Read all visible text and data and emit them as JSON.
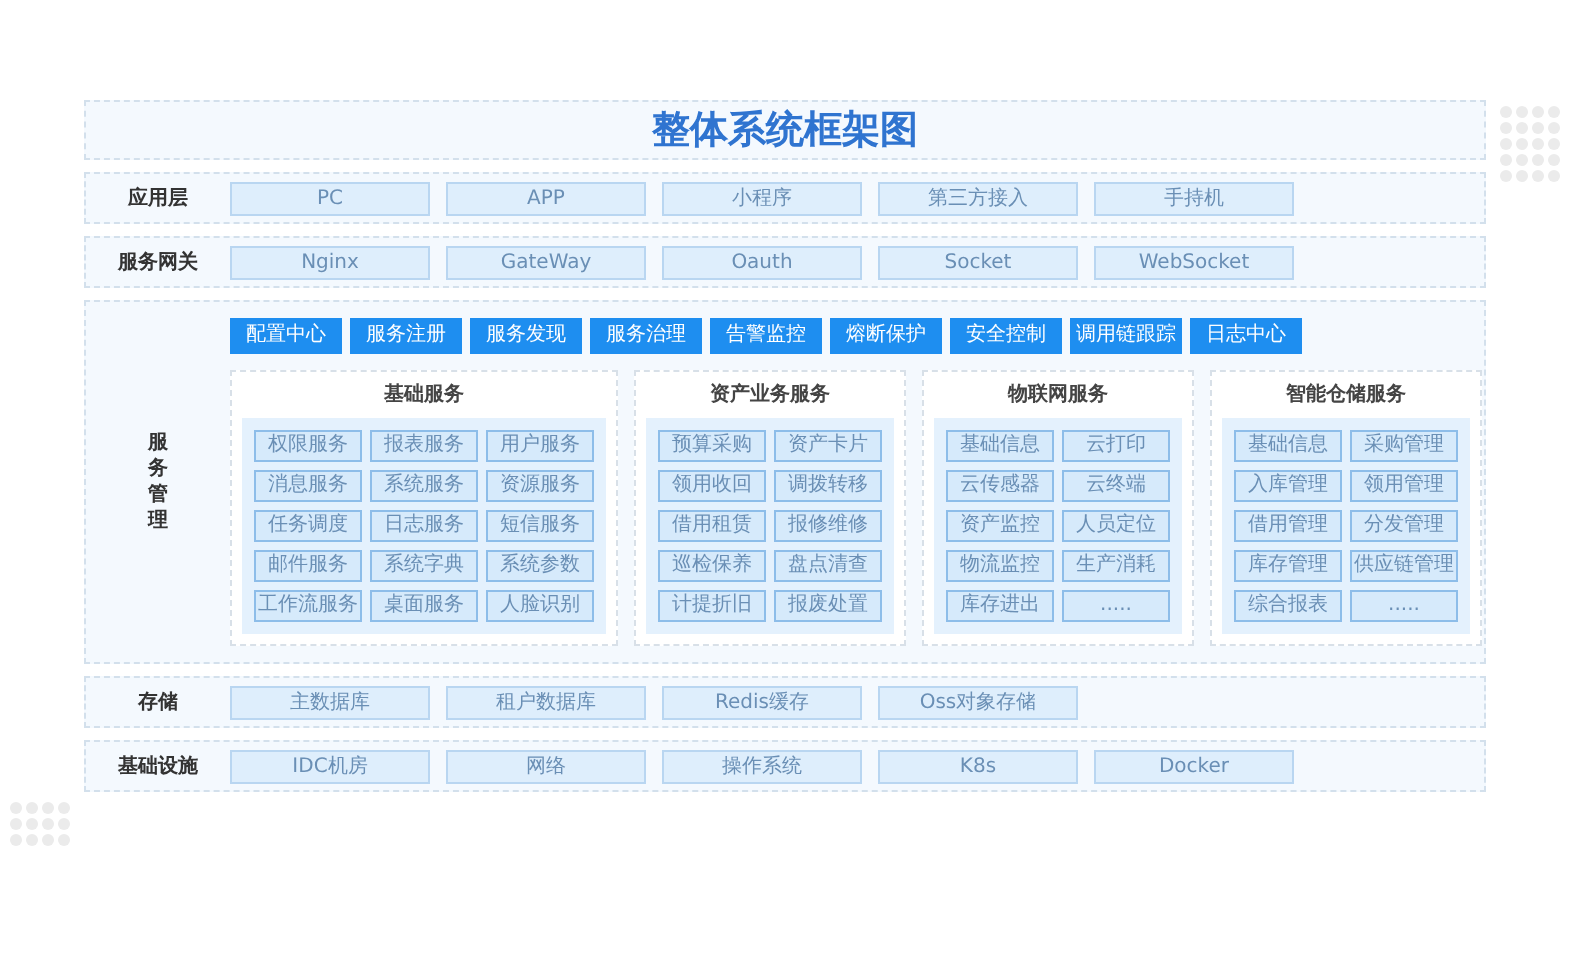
{
  "title": "整体系统框架图",
  "layers": [
    {
      "kind": "row",
      "label": "应用层",
      "items": [
        "PC",
        "APP",
        "小程序",
        "第三方接入",
        "手持机"
      ]
    },
    {
      "kind": "row",
      "label": "服务网关",
      "items": [
        "Nginx",
        "GateWay",
        "Oauth",
        "Socket",
        "WebSocket"
      ]
    },
    {
      "kind": "services",
      "label": "服务管理",
      "modules": [
        "配置中心",
        "服务注册",
        "服务发现",
        "服务治理",
        "告警监控",
        "熔断保护",
        "安全控制",
        "调用链跟踪",
        "日志中心"
      ],
      "groups": [
        {
          "title": "基础服务",
          "items": [
            "权限服务",
            "报表服务",
            "用户服务",
            "消息服务",
            "系统服务",
            "资源服务",
            "任务调度",
            "日志服务",
            "短信服务",
            "邮件服务",
            "系统字典",
            "系统参数",
            "工作流服务",
            "桌面服务",
            "人脸识别"
          ]
        },
        {
          "title": "资产业务服务",
          "items": [
            "预算采购",
            "资产卡片",
            "领用收回",
            "调拨转移",
            "借用租赁",
            "报修维修",
            "巡检保养",
            "盘点清查",
            "计提折旧",
            "报废处置"
          ]
        },
        {
          "title": "物联网服务",
          "items": [
            "基础信息",
            "云打印",
            "云传感器",
            "云终端",
            "资产监控",
            "人员定位",
            "物流监控",
            "生产消耗",
            "库存进出",
            "....."
          ]
        },
        {
          "title": "智能仓储服务",
          "items": [
            "基础信息",
            "采购管理",
            "入库管理",
            "领用管理",
            "借用管理",
            "分发管理",
            "库存管理",
            "供应链管理",
            "综合报表",
            "....."
          ]
        }
      ]
    },
    {
      "kind": "row",
      "label": "存储",
      "items": [
        "主数据库",
        "租户数据库",
        "Redis缓存",
        "Oss对象存储"
      ]
    },
    {
      "kind": "row",
      "label": "基础设施",
      "items": [
        "IDC机房",
        "网络",
        "操作系统",
        "K8s",
        "Docker"
      ]
    }
  ]
}
